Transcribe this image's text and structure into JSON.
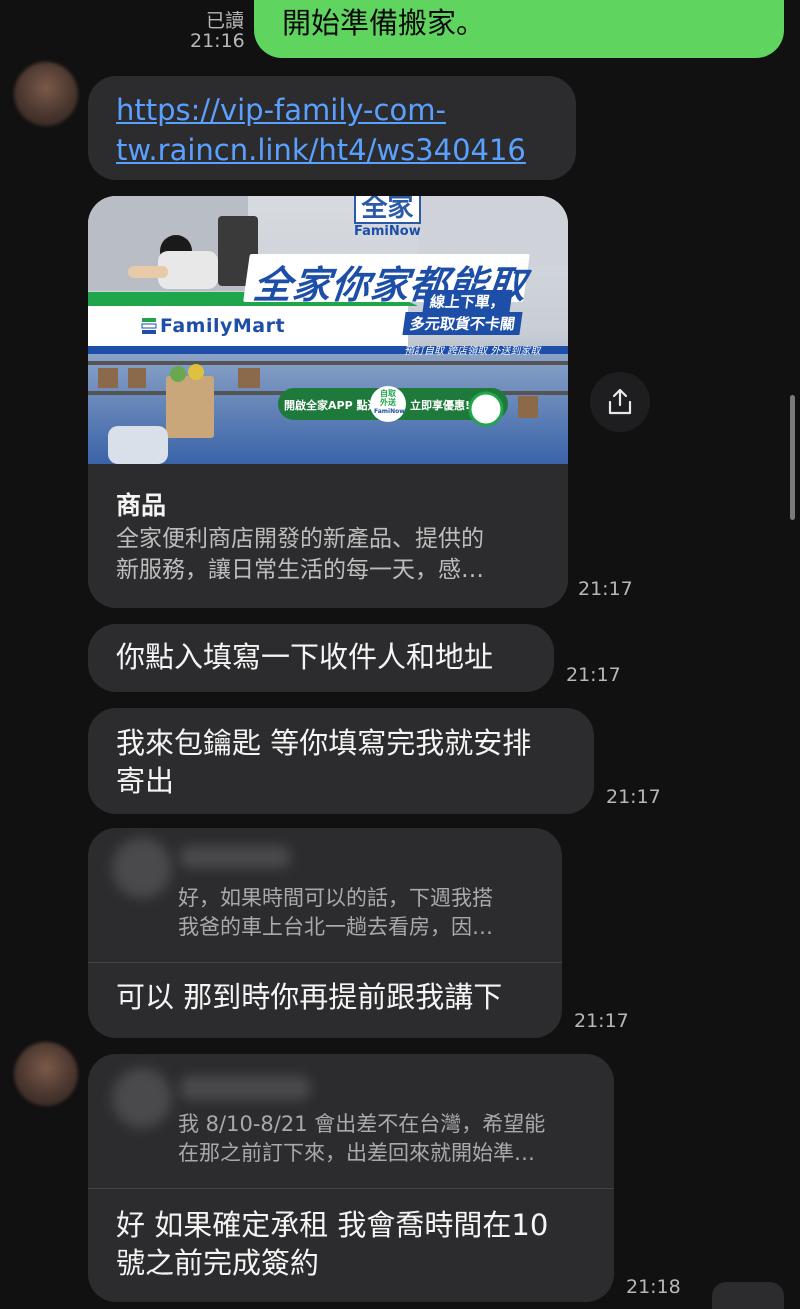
{
  "sent_message": {
    "text": "開始準備搬家。",
    "read_status": "已讀",
    "time": "21:16"
  },
  "link_message": {
    "line1": "https://vip-family-com-",
    "line2": "tw.raincn.link/ht4/ws340416"
  },
  "link_preview": {
    "banner": {
      "brand_logo_cn": "全家",
      "brand_logo_en": "FamiNow",
      "headline": "全家你家都能取",
      "sub1": "線上下單，",
      "sub2": "多元取貨不卡關",
      "tags": "預訂自取  跨店領取  外送到家取",
      "store_name": "FamilyMart",
      "cta_left": "開啟全家APP 點選",
      "cta_icon_top": "自取",
      "cta_icon_bottom": "外送",
      "cta_icon_label": "FamiNow",
      "cta_right": "立即享優惠!"
    },
    "title": "商品",
    "desc_line1": "全家便利商店開發的新產品、提供的",
    "desc_line2": "新服務，讓日常生活的每一天，感…",
    "time": "21:17"
  },
  "messages": [
    {
      "text": "你點入填寫一下收件人和地址",
      "time": "21:17"
    },
    {
      "line1": "我來包鑰匙 等你填寫完我就安排",
      "line2": "寄出",
      "time": "21:17"
    }
  ],
  "reply1": {
    "quote_line1": "好，如果時間可以的話，下週我搭",
    "quote_line2": "我爸的車上台北一趟去看房，因…",
    "text": "可以 那到時你再提前跟我講下",
    "time": "21:17"
  },
  "reply2": {
    "quote_line1": "我 8/10-8/21 會出差不在台灣，希望能",
    "quote_line2": "在那之前訂下來，出差回來就開始準…",
    "line1": "好 如果確定承租 我會喬時間在10",
    "line2": "號之前完成簽約",
    "time": "21:18"
  },
  "colors": {
    "background": "#111111",
    "bubble": "#2c2c2e",
    "sent_bubble": "#5fd45f",
    "link": "#5aa0ff",
    "familymart_green": "#1fa64a",
    "familymart_blue": "#1e4fa8"
  }
}
